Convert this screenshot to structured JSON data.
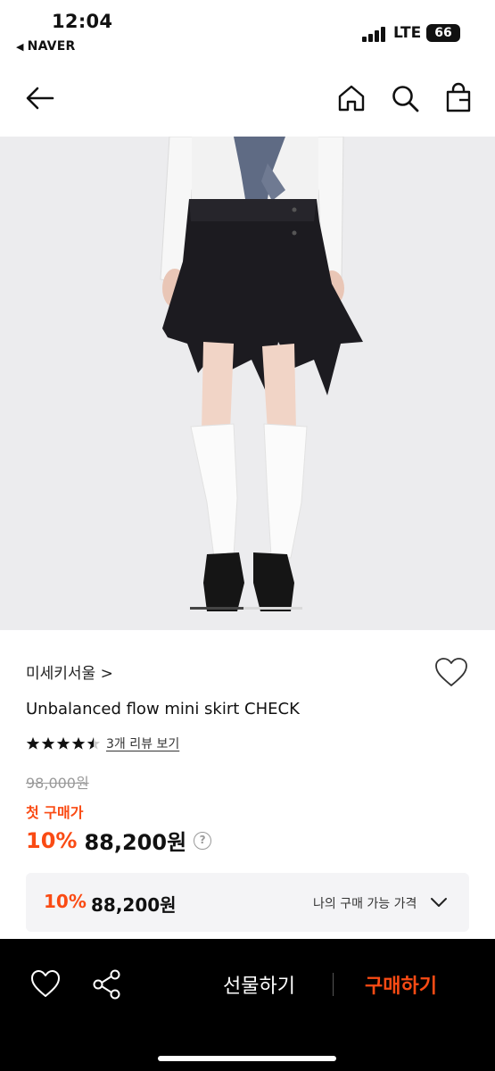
{
  "status_bar": {
    "time": "12:04",
    "back_app": "NAVER",
    "network": "LTE",
    "battery": "66"
  },
  "nav": {
    "icons": [
      "back-arrow-icon",
      "home-icon",
      "search-icon",
      "shopping-bag-icon"
    ]
  },
  "product": {
    "brand": "미세키서울 >",
    "title": "Unbalanced flow mini skirt CHECK",
    "rating": 4.5,
    "review_link": "3개 리뷰 보기",
    "original_price": "98,000원",
    "first_purchase_label": "첫 구매가",
    "discount": "10%",
    "sale_price": "88,200원",
    "help": "?"
  },
  "my_price": {
    "discount": "10%",
    "price": "88,200원",
    "label": "나의 구매 가능 가격"
  },
  "bottom_bar": {
    "gift_label": "선물하기",
    "buy_label": "구매하기"
  },
  "colors": {
    "accent": "#fa4b14",
    "bottom_bar": "#000000"
  }
}
